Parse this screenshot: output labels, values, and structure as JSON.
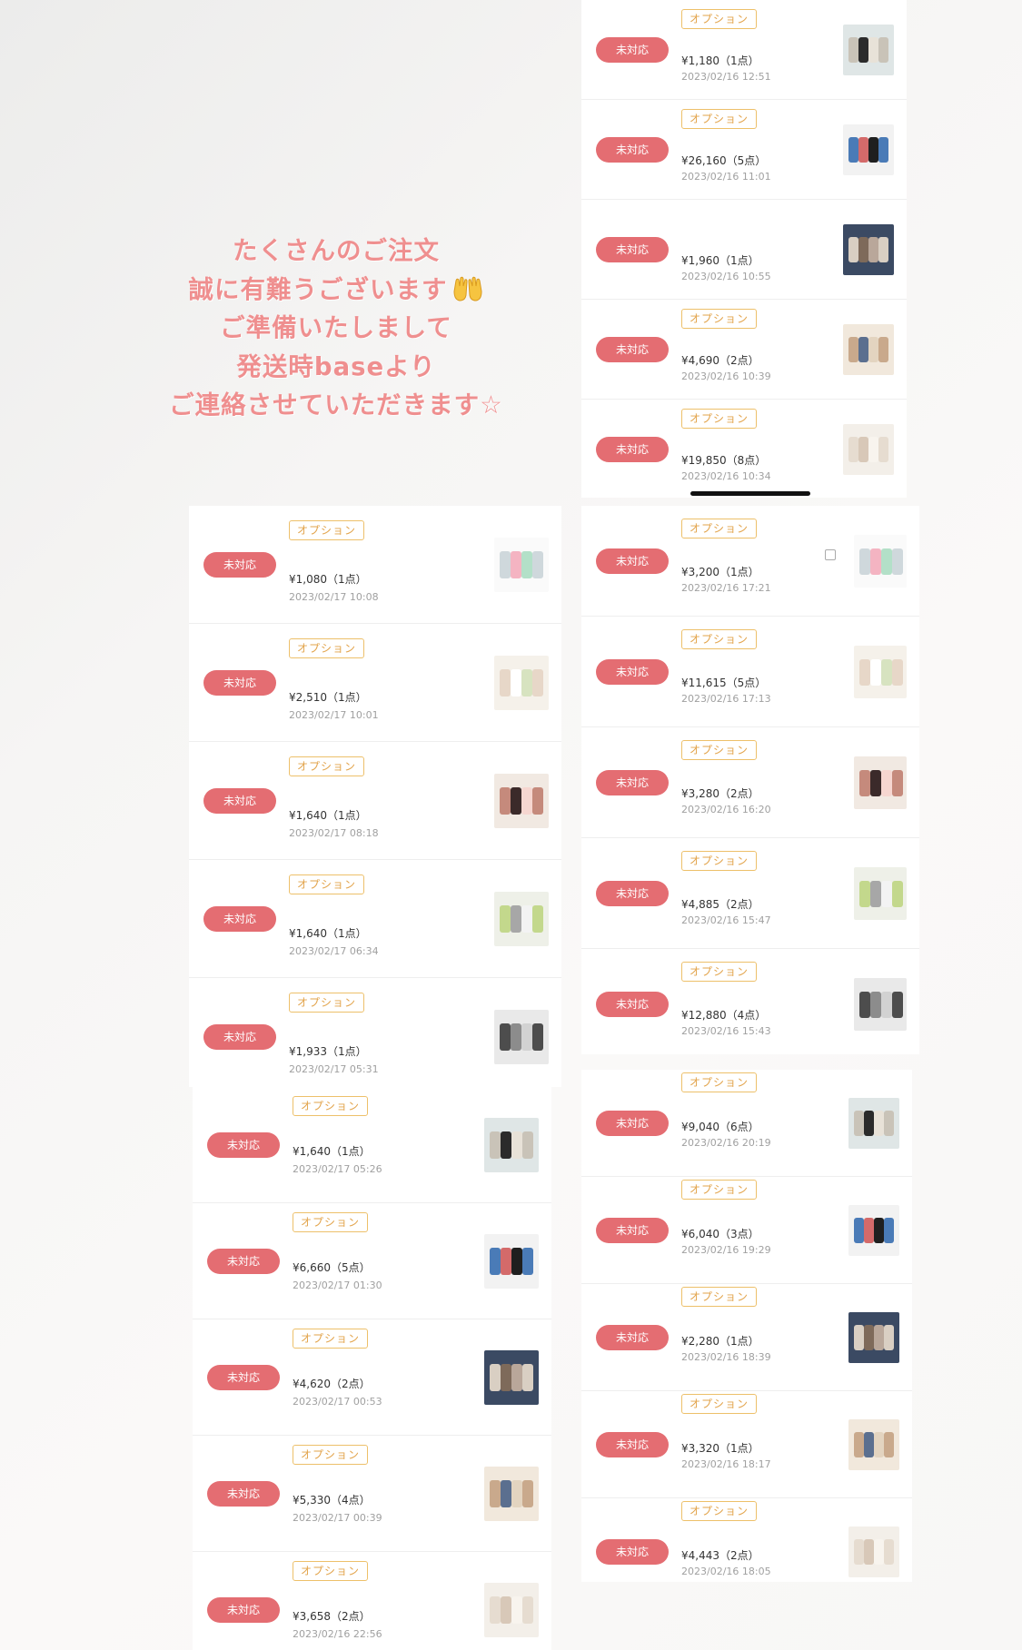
{
  "message": {
    "lines": [
      "たくさんのご注文",
      "誠に有難うございます",
      "ご準備いたしまして",
      "発送時baseより",
      "ご連絡させていただきます☆"
    ],
    "emoji_icon": "raising-hands-icon"
  },
  "labels": {
    "status": "未対応",
    "option": "オプション"
  },
  "colors": {
    "status_badge": "#e46d72",
    "option_border": "#edc06a",
    "option_text": "#e2a34a",
    "message_text": "#ef8f8f"
  },
  "panels": {
    "top_right": {
      "orders": [
        {
          "price": "¥1,180（1点）",
          "date": "2023/02/16 12:51",
          "option": true
        },
        {
          "price": "¥26,160（5点）",
          "date": "2023/02/16 11:01",
          "option": true
        },
        {
          "price": "¥1,960（1点）",
          "date": "2023/02/16 10:55",
          "option": false
        },
        {
          "price": "¥4,690（2点）",
          "date": "2023/02/16 10:39",
          "option": true
        },
        {
          "price": "¥19,850（8点）",
          "date": "2023/02/16 10:34",
          "option": true
        }
      ]
    },
    "left_upper": {
      "orders": [
        {
          "price": "¥1,080（1点）",
          "date": "2023/02/17 10:08",
          "option": true
        },
        {
          "price": "¥2,510（1点）",
          "date": "2023/02/17 10:01",
          "option": true
        },
        {
          "price": "¥1,640（1点）",
          "date": "2023/02/17 08:18",
          "option": true
        },
        {
          "price": "¥1,640（1点）",
          "date": "2023/02/17 06:34",
          "option": true
        },
        {
          "price": "¥1,933（1点）",
          "date": "2023/02/17 05:31",
          "option": true
        }
      ]
    },
    "left_lower": {
      "orders": [
        {
          "price": "¥1,640（1点）",
          "date": "2023/02/17 05:26",
          "option": true
        },
        {
          "price": "¥6,660（5点）",
          "date": "2023/02/17 01:30",
          "option": true
        },
        {
          "price": "¥4,620（2点）",
          "date": "2023/02/17 00:53",
          "option": true
        },
        {
          "price": "¥5,330（4点）",
          "date": "2023/02/17 00:39",
          "option": true
        },
        {
          "price": "¥3,658（2点）",
          "date": "2023/02/16 22:56",
          "option": true
        }
      ]
    },
    "right_middle": {
      "orders": [
        {
          "price": "¥3,200（1点）",
          "date": "2023/02/16 17:21",
          "option": true
        },
        {
          "price": "¥11,615（5点）",
          "date": "2023/02/16 17:13",
          "option": true
        },
        {
          "price": "¥3,280（2点）",
          "date": "2023/02/16 16:20",
          "option": true
        },
        {
          "price": "¥4,885（2点）",
          "date": "2023/02/16 15:47",
          "option": true
        },
        {
          "price": "¥12,880（4点）",
          "date": "2023/02/16 15:43",
          "option": true
        }
      ]
    },
    "right_lower": {
      "orders": [
        {
          "price": "¥9,040（6点）",
          "date": "2023/02/16 20:19",
          "option": true
        },
        {
          "price": "¥6,040（3点）",
          "date": "2023/02/16 19:29",
          "option": true
        },
        {
          "price": "¥2,280（1点）",
          "date": "2023/02/16 18:39",
          "option": true
        },
        {
          "price": "¥3,320（1点）",
          "date": "2023/02/16 18:17",
          "option": true
        },
        {
          "price": "¥4,443（2点）",
          "date": "2023/02/16 18:05",
          "option": true
        }
      ]
    }
  }
}
